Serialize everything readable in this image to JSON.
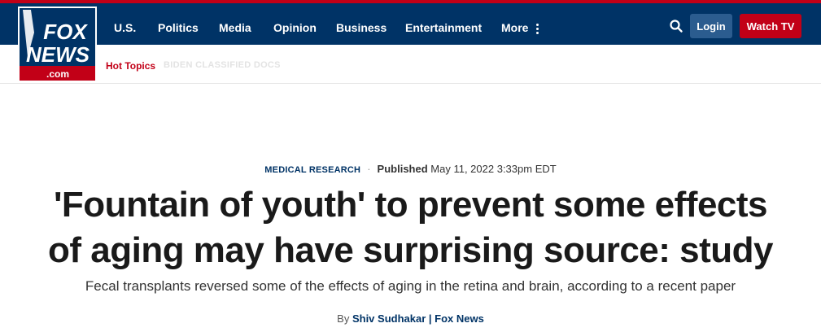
{
  "brand": {
    "logo_top": "FOX",
    "logo_bottom": "NEWS",
    "logo_suffix": ".com"
  },
  "nav": {
    "items": [
      {
        "label": "U.S."
      },
      {
        "label": "Politics"
      },
      {
        "label": "Media"
      },
      {
        "label": "Opinion"
      },
      {
        "label": "Business"
      },
      {
        "label": "Entertainment"
      },
      {
        "label": "More"
      }
    ],
    "login_label": "Login",
    "watch_label": "Watch TV"
  },
  "hot_topics": {
    "label": "Hot Topics",
    "items": [
      "BIDEN CLASSIFIED DOCS"
    ]
  },
  "article": {
    "category": "MEDICAL RESEARCH",
    "published_label": "Published",
    "published_date": "May 11, 2022 3:33pm EDT",
    "headline_line1": "'Fountain of youth' to prevent some effects",
    "headline_line2": "of aging may have surprising source: study",
    "subhead": "Fecal transplants reversed some of the effects of aging in the retina and brain, according to a recent paper",
    "by": "By",
    "author": "Shiv Sudhakar",
    "separator": "|",
    "outlet": "Fox News"
  },
  "colors": {
    "navy": "#003366",
    "red": "#c20017",
    "login_bg": "#2b5c8f"
  }
}
